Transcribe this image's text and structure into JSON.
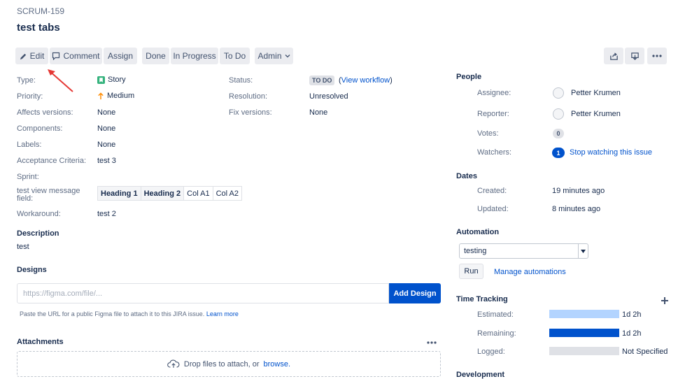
{
  "issue": {
    "key": "SCRUM-159",
    "title": "test tabs"
  },
  "toolbar": {
    "edit": "Edit",
    "comment": "Comment",
    "assign": "Assign",
    "done": "Done",
    "in_progress": "In Progress",
    "to_do": "To Do",
    "admin": "Admin"
  },
  "details": {
    "type_label": "Type:",
    "type_value": "Story",
    "priority_label": "Priority:",
    "priority_value": "Medium",
    "affects_label": "Affects versions:",
    "affects_value": "None",
    "components_label": "Components:",
    "components_value": "None",
    "labels_label": "Labels:",
    "labels_value": "None",
    "acceptance_label": "Acceptance Criteria:",
    "acceptance_value": "test 3",
    "sprint_label": "Sprint:",
    "message_label": "test view message field:",
    "workaround_label": "Workaround:",
    "workaround_value": "test 2",
    "status_label": "Status:",
    "status_value": "TO DO",
    "view_workflow": "View workflow",
    "resolution_label": "Resolution:",
    "resolution_value": "Unresolved",
    "fix_label": "Fix versions:",
    "fix_value": "None"
  },
  "message_table": {
    "headers": [
      "Heading 1",
      "Heading 2"
    ],
    "cells": [
      "Col A1",
      "Col A2"
    ]
  },
  "description": {
    "heading": "Description",
    "text": "test"
  },
  "designs": {
    "heading": "Designs",
    "placeholder": "https://figma.com/file/...",
    "button": "Add Design",
    "hint": "Paste the URL for a public Figma file to attach it to this JIRA issue.",
    "learn_more": "Learn more"
  },
  "attachments": {
    "heading": "Attachments",
    "drop_text": "Drop files to attach, or",
    "browse": "browse."
  },
  "people": {
    "heading": "People",
    "assignee_label": "Assignee:",
    "assignee": "Petter Krumen",
    "reporter_label": "Reporter:",
    "reporter": "Petter Krumen",
    "votes_label": "Votes:",
    "votes": "0",
    "watchers_label": "Watchers:",
    "watchers": "1",
    "stop_watching": "Stop watching this issue"
  },
  "dates": {
    "heading": "Dates",
    "created_label": "Created:",
    "created": "19 minutes ago",
    "updated_label": "Updated:",
    "updated": "8 minutes ago"
  },
  "automation": {
    "heading": "Automation",
    "selected": "testing",
    "run": "Run",
    "manage": "Manage automations"
  },
  "time_tracking": {
    "heading": "Time Tracking",
    "estimated_label": "Estimated:",
    "estimated": "1d 2h",
    "estimated_fill": 1.0,
    "remaining_label": "Remaining:",
    "remaining": "1d 2h",
    "remaining_fill": 1.0,
    "logged_label": "Logged:",
    "logged": "Not Specified",
    "logged_fill": 0.0
  },
  "development": {
    "heading": "Development"
  },
  "colors": {
    "primary": "#0052cc",
    "estimated_bar": "#b3d4ff",
    "remaining_bar": "#0052cc",
    "logged_bar": "#dfe1e6",
    "arrow": "#e53935",
    "story_icon": "#36b37e",
    "priority_icon": "#ff8b00"
  }
}
